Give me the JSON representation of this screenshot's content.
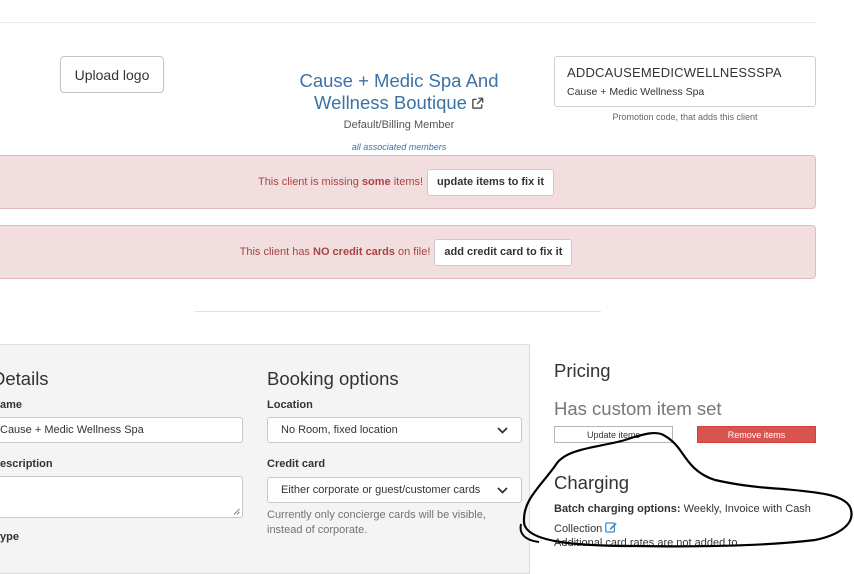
{
  "header": {
    "upload_logo_label": "Upload logo",
    "client_name": "Cause + Medic Spa And Wellness Boutique",
    "role_label": "Default/Billing Member",
    "members_link": "all associated members",
    "external_link_icon": "external-link-icon"
  },
  "promo": {
    "code": "ADDCAUSEMEDICWELLNESSSPA",
    "client": "Cause + Medic Wellness Spa",
    "caption": "Promotion code, that adds this client"
  },
  "alerts": [
    {
      "text_before": "This client is missing ",
      "emphasis": "some",
      "text_after": " items!",
      "button_label": "update items to fix it"
    },
    {
      "text_before": "This client has ",
      "emphasis": "NO credit cards",
      "text_after": " on file!",
      "button_label": "add credit card to fix it"
    }
  ],
  "details": {
    "title": "Details",
    "name_label": "ame",
    "name_value": "Cause + Medic Wellness Spa",
    "description_label": "escription",
    "description_value": "",
    "type_label": "ype"
  },
  "booking": {
    "title": "Booking options",
    "location_label": "Location",
    "location_value": "No Room, fixed location",
    "credit_card_label": "Credit card",
    "credit_card_value": "Either corporate or guest/customer cards",
    "helper_text": "Currently only concierge cards will be visible, instead of corporate."
  },
  "pricing": {
    "title": "Pricing",
    "custom_item_set": "Has custom item set",
    "update_items_label": "Update items",
    "remove_items_label": "Remove items"
  },
  "charging": {
    "title": "Charging",
    "batch_label": "Batch charging options:",
    "batch_value": "Weekly, Invoice with Cash Collection",
    "edit_icon": "edit-icon",
    "additional_text": "Additional card rates are not added to"
  },
  "colors": {
    "link_blue": "#3d72a6",
    "alert_bg": "#f2dede",
    "alert_text": "#a94442",
    "danger": "#d9534f"
  }
}
